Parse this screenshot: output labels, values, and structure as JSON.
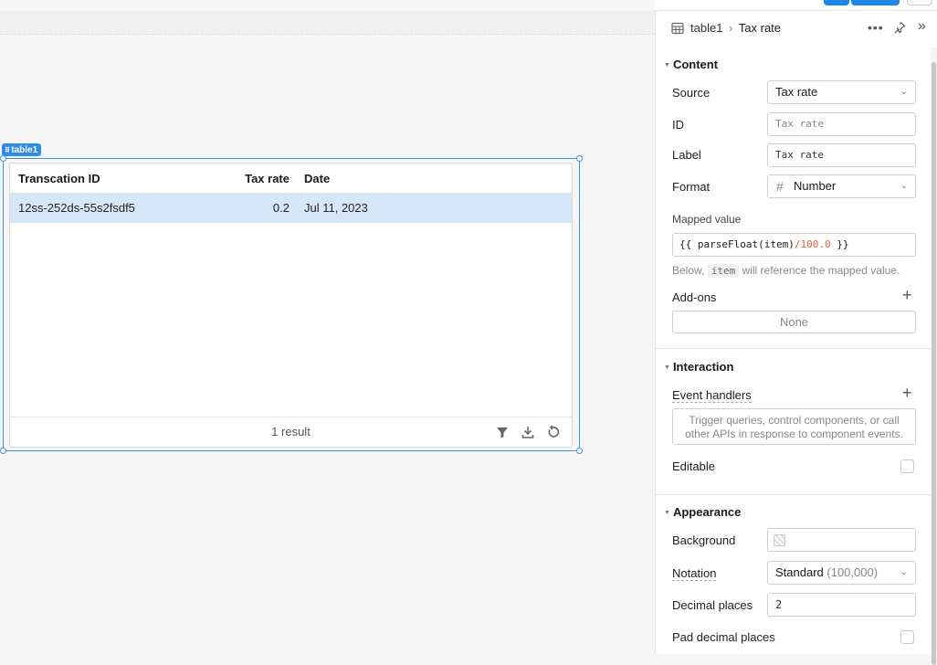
{
  "table_component": {
    "tag": "table1",
    "columns": [
      "Transcation ID",
      "Tax rate",
      "Date"
    ],
    "rows": [
      {
        "id": "12ss-252ds-55s2fsdf5",
        "tax_rate": "0.2",
        "date": "Jul 11, 2023"
      }
    ],
    "footer_count": "1 result"
  },
  "panel": {
    "breadcrumb_parent": "table1",
    "breadcrumb_sep": "›",
    "breadcrumb_current": "Tax rate",
    "content": {
      "title": "Content",
      "source_label": "Source",
      "source_value": "Tax rate",
      "id_label": "ID",
      "id_placeholder": "Tax rate",
      "label_label": "Label",
      "label_value": "Tax rate",
      "format_label": "Format",
      "format_value": "Number",
      "mapped_label": "Mapped value",
      "mapped_open": "{{ parseFloat(item)",
      "mapped_op": "/100.0",
      "mapped_close": " }}",
      "hint_before": "Below,",
      "hint_code": "item",
      "hint_after": "will reference the mapped value.",
      "addons_label": "Add-ons",
      "addons_value": "None"
    },
    "interaction": {
      "title": "Interaction",
      "event_handlers_label": "Event handlers",
      "event_handlers_hint": "Trigger queries, control components, or call other APIs in response to component events.",
      "editable_label": "Editable"
    },
    "appearance": {
      "title": "Appearance",
      "background_label": "Background",
      "notation_label": "Notation",
      "notation_value": "Standard",
      "notation_sub": "(100,000)",
      "decimal_label": "Decimal places",
      "decimal_value": "2",
      "pad_label": "Pad decimal places"
    }
  },
  "colors": {
    "accent": "#2f8be8",
    "selected_row": "#d6e8f7",
    "highlight": "#e53935",
    "mapped_op": "#d9673a"
  }
}
